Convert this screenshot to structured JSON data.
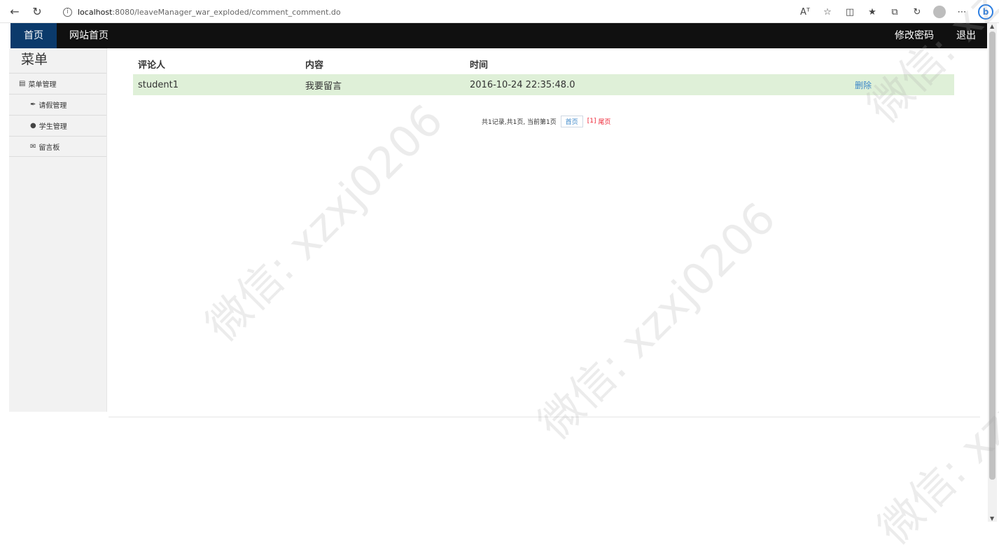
{
  "browser": {
    "url_host": "localhost",
    "url_path": ":8080/leaveManager_war_exploded/comment_comment.do",
    "tools": [
      "Aᵀ",
      "☆",
      "◫",
      "★",
      "⧉",
      "↻",
      "⋯"
    ]
  },
  "navbar": {
    "home": "首页",
    "site_home": "网站首页",
    "change_password": "修改密码",
    "logout": "退出"
  },
  "sidebar": {
    "title": "菜单",
    "items": [
      {
        "label": "菜单管理",
        "icon": "menu-icon"
      },
      {
        "label": "请假管理",
        "icon": "pen-icon"
      },
      {
        "label": "学生管理",
        "icon": "comment-icon"
      },
      {
        "label": "留言板",
        "icon": "envelope-icon"
      }
    ]
  },
  "table": {
    "headers": [
      "评论人",
      "内容",
      "时间",
      ""
    ],
    "rows": [
      {
        "commenter": "student1",
        "content": "我要留言",
        "time": "2016-10-24 22:35:48.0",
        "action": "删除"
      }
    ]
  },
  "pager": {
    "summary": "共1记录,共1页, 当前第1页",
    "first": "首页",
    "current": "[1]",
    "last": "尾页"
  },
  "watermark": "微信: xzxj0206"
}
